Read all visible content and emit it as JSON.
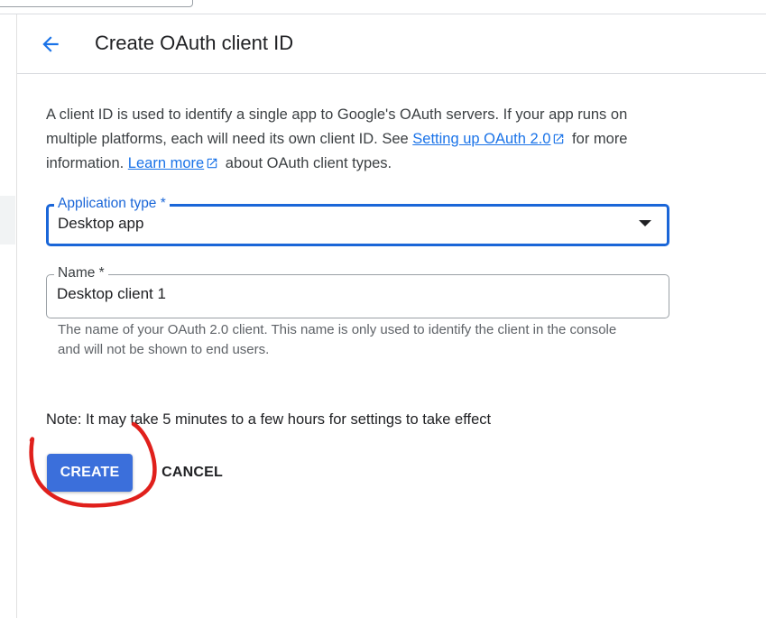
{
  "header": {
    "back_icon": "arrow-back-icon",
    "title": "Create OAuth client ID"
  },
  "description": {
    "text_1": "A client ID is used to identify a single app to Google's OAuth servers. If your app runs on multiple platforms, each will need its own client ID. See ",
    "link_1": "Setting up OAuth 2.0",
    "text_2": " for more information. ",
    "link_2": "Learn more",
    "text_3": " about OAuth client types.",
    "link_icon": "open-in-new-icon"
  },
  "application_type": {
    "label": "Application type *",
    "value": "Desktop app"
  },
  "name_field": {
    "label": "Name *",
    "value": "Desktop client 1",
    "hint": "The name of your OAuth 2.0 client. This name is only used to identify the client in the console and will not be shown to end users."
  },
  "note": "Note: It may take 5 minutes to a few hours for settings to take effect",
  "actions": {
    "create_label": "CREATE",
    "cancel_label": "CANCEL"
  },
  "colors": {
    "accent": "#1a73e8",
    "focused_border": "#1a66d8",
    "primary_button": "#3b6fdb",
    "annotation": "#e0201c"
  }
}
